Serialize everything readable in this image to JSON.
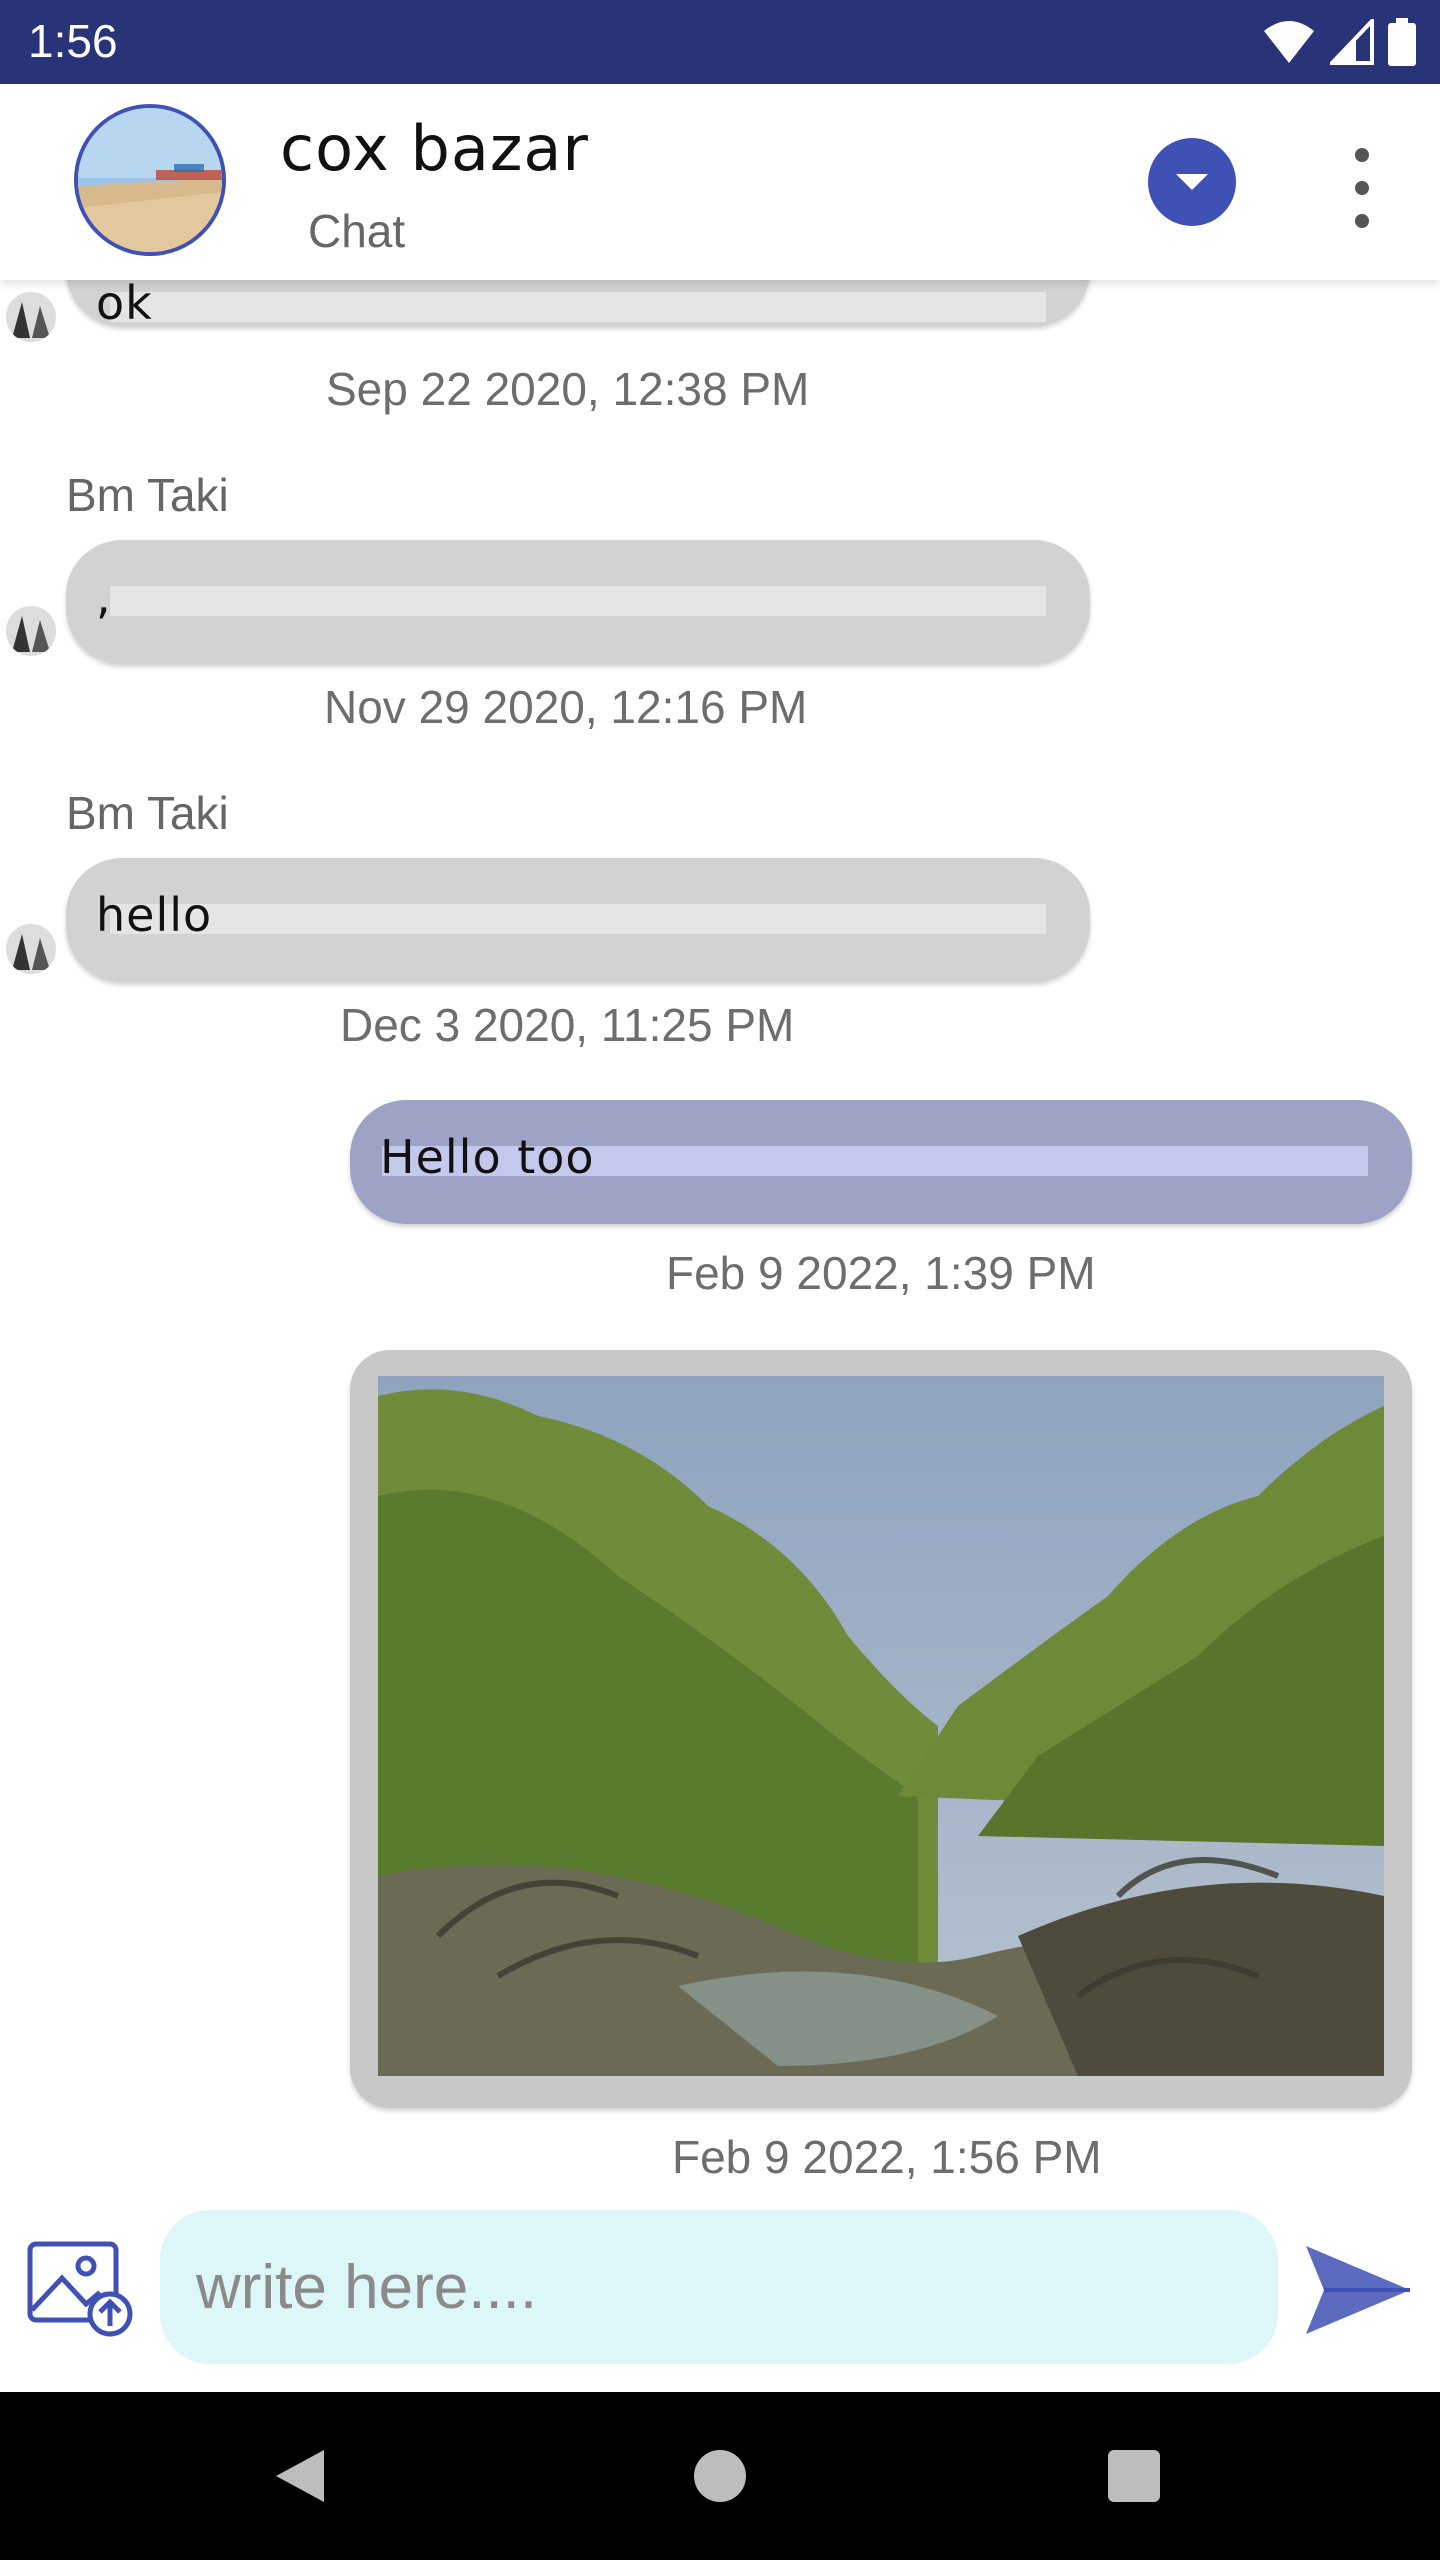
{
  "status_bar": {
    "time": "1:56",
    "icons": [
      "wifi-icon",
      "cellular-signal-icon",
      "battery-icon"
    ]
  },
  "header": {
    "title": "cox bazar",
    "subtitle": "Chat"
  },
  "messages": [
    {
      "direction": "incoming",
      "sender": "",
      "text": "ok",
      "timestamp": "Sep 22 2020, 12:38 PM"
    },
    {
      "direction": "incoming",
      "sender": "Bm Taki",
      "text": ",",
      "timestamp": "Nov 29 2020, 12:16 PM"
    },
    {
      "direction": "incoming",
      "sender": "Bm Taki",
      "text": "hello",
      "timestamp": "Dec 3 2020, 11:25 PM"
    },
    {
      "direction": "outgoing",
      "text": "Hello too",
      "timestamp": "Feb 9 2022, 1:39 PM"
    },
    {
      "direction": "outgoing",
      "type": "image",
      "timestamp": "Feb 9 2022, 1:56 PM"
    }
  ],
  "composer": {
    "placeholder": "write here....",
    "value": ""
  },
  "colors": {
    "primary": "#3f51b5",
    "status_bar": "#283378",
    "incoming_bubble": "#d2d2d2",
    "outgoing_bubble": "#9ea3c6",
    "input_background": "#ddf6f7"
  }
}
